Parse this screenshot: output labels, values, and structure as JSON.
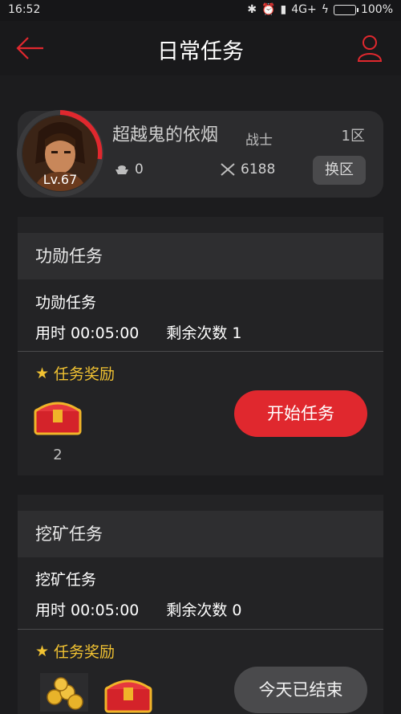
{
  "status": {
    "time": "16:52",
    "network": "4G+",
    "battery": "100%"
  },
  "header": {
    "title": "日常任务",
    "back_icon": "arrow-left-icon",
    "user_icon": "user-icon",
    "accent": "#e0282e"
  },
  "profile": {
    "level": "Lv.67",
    "name": "超越鬼的依烟",
    "class": "战士",
    "zone": "1区",
    "silver": "0",
    "power": "6188",
    "switch_label": "换区"
  },
  "tasks": [
    {
      "header": "功勋任务",
      "name": "功勋任务",
      "time": "用时 00:05:00",
      "remaining": "剩余次数 1",
      "reward_label": "任务奖励",
      "reward_count": "2",
      "action_label": "开始任务"
    },
    {
      "header": "挖矿任务",
      "name": "挖矿任务",
      "time": "用时 00:05:00",
      "remaining": "剩余次数 0",
      "reward_label": "任务奖励",
      "action_label": "今天已结束"
    }
  ]
}
